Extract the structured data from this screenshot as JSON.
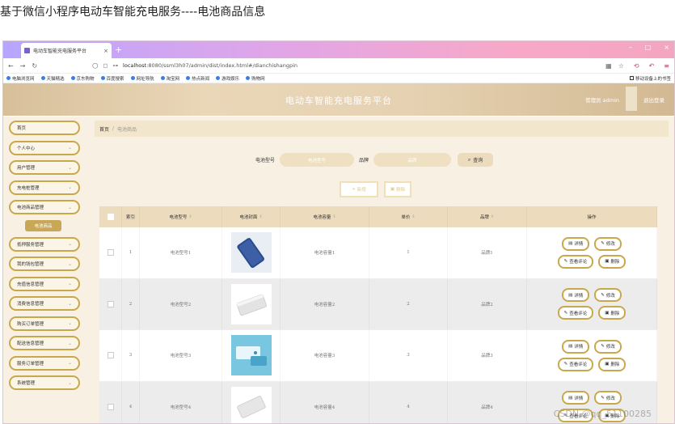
{
  "caption": "基于微信小程序电动车智能充电服务----电池商品信息",
  "browser": {
    "tab_title": "电动车智能充电服务平台",
    "tab_close": "×",
    "new_tab": "+",
    "win_min": "–",
    "win_max": "□",
    "win_close": "×",
    "url_host": "localhost",
    "url_rest": ":8080/ssml3h07/admin/dist/index.html#/dianchishangpin",
    "bookmarks": [
      "电脑浏览网",
      "天猫精选",
      "京东购物",
      "百度搜索",
      "网址导航",
      "淘宝网",
      "热点新闻",
      "游戏娱乐",
      "购物网"
    ],
    "mobile_bookmark": "移动设备上的书签"
  },
  "header": {
    "title": "电动车智能充电服务平台",
    "user": "管理员 admin",
    "logout": "退出登录"
  },
  "sidebar": {
    "items": [
      {
        "label": "首页",
        "chev": ""
      },
      {
        "label": "个人中心",
        "chev": "⌄"
      },
      {
        "label": "用户管理",
        "chev": "⌄"
      },
      {
        "label": "充电桩管理",
        "chev": "⌄"
      },
      {
        "label": "电池商品管理",
        "chev": "⌄"
      }
    ],
    "sub_active": "电池商品",
    "items2": [
      {
        "label": "抵押服务管理",
        "chev": "⌄"
      },
      {
        "label": "我的钱包管理",
        "chev": "⌄"
      },
      {
        "label": "充值信息管理",
        "chev": "⌄"
      },
      {
        "label": "消费信息管理",
        "chev": "⌄"
      },
      {
        "label": "购买订单管理",
        "chev": "⌄"
      },
      {
        "label": "配送信息管理",
        "chev": "⌄"
      },
      {
        "label": "服务订单管理",
        "chev": "⌄"
      },
      {
        "label": "系统管理",
        "chev": "⌄"
      }
    ]
  },
  "breadcrumb": {
    "home": "首页",
    "sep": "/",
    "current": "电池商品"
  },
  "search": {
    "label1": "电池型号",
    "placeholder1": "电池型号",
    "label2": "品牌",
    "placeholder2": "品牌",
    "button": "查询"
  },
  "actions": {
    "add": "新增",
    "delete": "删除"
  },
  "table": {
    "headers": {
      "index": "索引",
      "model": "电池型号",
      "cover": "电池封面",
      "capacity": "电池容量",
      "price": "单价",
      "brand": "品牌",
      "ops": "操作"
    },
    "rows": [
      {
        "index": "1",
        "model": "电池型号1",
        "capacity": "电池容量1",
        "price": "1",
        "brand": "品牌1"
      },
      {
        "index": "2",
        "model": "电池型号2",
        "capacity": "电池容量2",
        "price": "2",
        "brand": "品牌2"
      },
      {
        "index": "3",
        "model": "电池型号3",
        "capacity": "电池容量3",
        "price": "3",
        "brand": "品牌3"
      },
      {
        "index": "4",
        "model": "电池型号4",
        "capacity": "电池容量4",
        "price": "4",
        "brand": "品牌4"
      }
    ],
    "ops": {
      "detail": "详情",
      "edit": "修改",
      "comments": "查看评论",
      "delete": "删除"
    }
  },
  "watermark": "CSDN @qq_51100285",
  "colors": {
    "accent": "#c9a84c",
    "header_bg": "#ecdcbd",
    "content_bg": "#f8f1e3"
  }
}
